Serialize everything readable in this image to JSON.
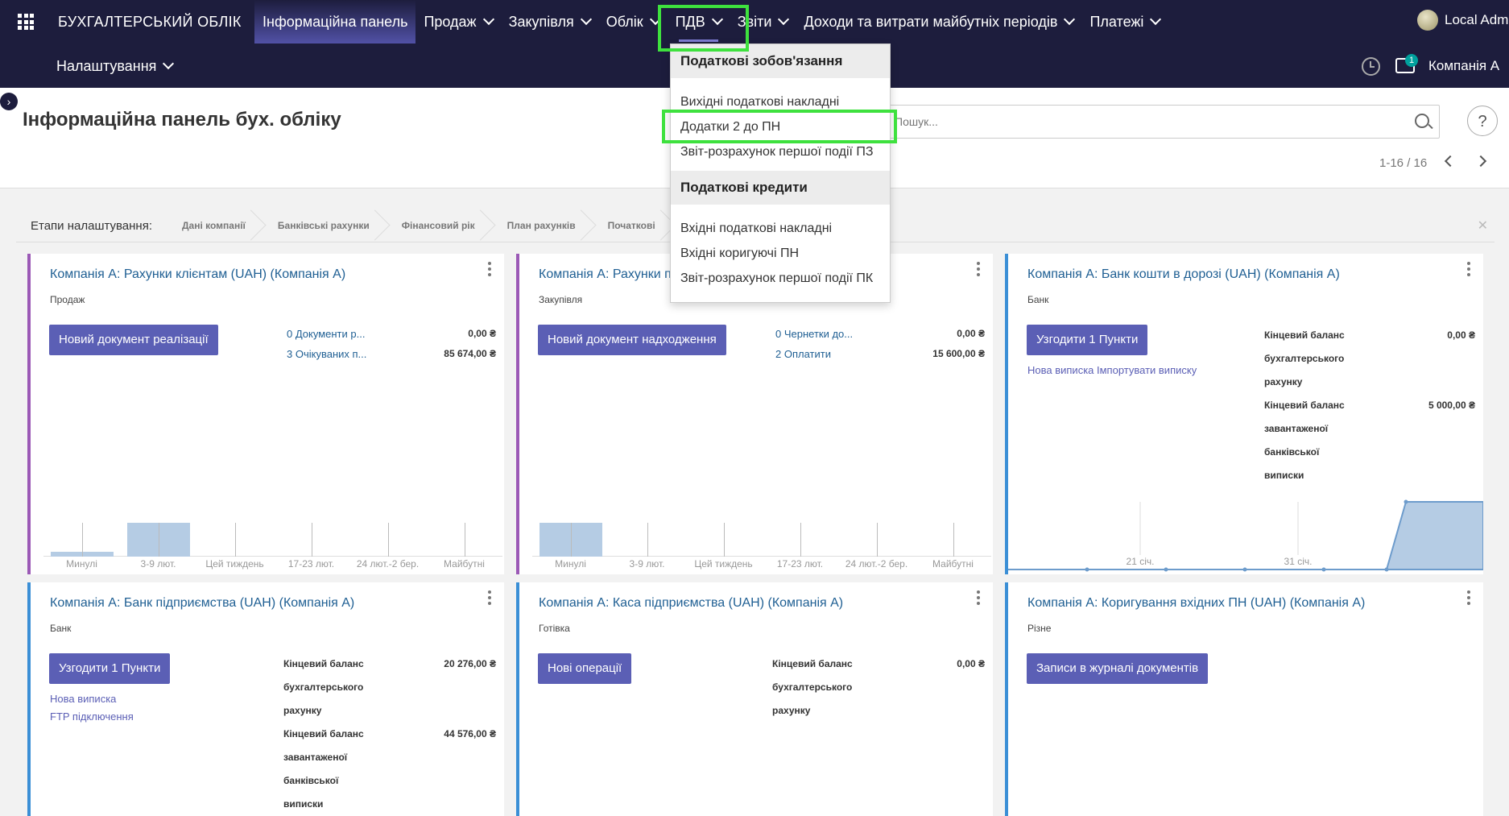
{
  "topbar": {
    "app_name": "БУХГАЛТЕРСЬКИЙ ОБЛІК",
    "menu": [
      "Інформаційна панель",
      "Продаж",
      "Закупівля",
      "Облік",
      "ПДВ",
      "Звіти",
      "Доходи та витрати майбутніх періодів",
      "Платежі"
    ],
    "settings": "Налаштування",
    "user_name": "Local Adm",
    "company": "Компанія А",
    "messages_count": "1"
  },
  "control": {
    "title": "Інформаційна панель бух. обліку",
    "search_placeholder": "Пошук...",
    "pager": "1-16 / 16",
    "help": "?"
  },
  "setup": {
    "label": "Етапи налаштування:",
    "steps": [
      "Дані компанії",
      "Банківські рахунки",
      "Фінансовий рік",
      "План рахунків",
      "Початкові"
    ]
  },
  "vat_menu": {
    "sections": [
      {
        "header": "Податкові зобов'язання",
        "items": [
          "Вихідні податкові накладні",
          "Додатки 2 до ПН",
          "Звіт-розрахунок першої події ПЗ"
        ]
      },
      {
        "header": "Податкові кредити",
        "items": [
          "Вхідні податкові накладні",
          "Вхідні коригуючі ПН",
          "Звіт-розрахунок першої події ПК"
        ]
      }
    ]
  },
  "cards": {
    "sales": {
      "title": "Компанія А: Рахунки клієнтам (UAH) (Компанія А)",
      "type": "Продаж",
      "button": "Новий документ реалізації",
      "stats": [
        {
          "label": "0 Документи р...",
          "value": "0,00 ₴"
        },
        {
          "label": "3 Очікуваних п...",
          "value": "85 674,00 ₴"
        }
      ]
    },
    "purchase": {
      "title": "Компанія А: Рахунки п",
      "type": "Закупівля",
      "button": "Новий документ надходження",
      "stats": [
        {
          "label": "0 Чернетки до...",
          "value": "0,00 ₴"
        },
        {
          "label": "2 Оплатити",
          "value": "15 600,00 ₴"
        }
      ]
    },
    "transit": {
      "title": "Компанія А: Банк кошти в дорозі (UAH) (Компанія А)",
      "type": "Банк",
      "button": "Узгодити 1 Пункти",
      "links": "Нова виписка Імпортувати виписку",
      "balance_lines": [
        "Кінцевий баланс",
        "бухгалтерського",
        "рахунку",
        "Кінцевий баланс",
        "завантаженої",
        "банківської",
        "виписки"
      ],
      "balance_values": [
        "0,00 ₴",
        "5 000,00 ₴"
      ]
    },
    "bank": {
      "title": "Компанія А: Банк підприємства (UAH) (Компанія А)",
      "type": "Банк",
      "button": "Узгодити 1 Пункти",
      "links": [
        "Нова виписка",
        "FTP підключення"
      ],
      "balance_lines": [
        "Кінцевий баланс",
        "бухгалтерського",
        "рахунку",
        "Кінцевий баланс",
        "завантаженої",
        "банківської",
        "виписки"
      ],
      "balance_values": [
        "20 276,00 ₴",
        "44 576,00 ₴"
      ]
    },
    "cash": {
      "title": "Компанія А: Каса підприємства (UAH) (Компанія А)",
      "type": "Готівка",
      "button": "Нові операції",
      "balance_lines": [
        "Кінцевий баланс",
        "бухгалтерського",
        "рахунку"
      ],
      "balance_values": [
        "0,00 ₴"
      ]
    },
    "correction": {
      "title": "Компанія А: Коригування вхідних ПН (UAH) (Компанія А)",
      "type": "Різне",
      "button": "Записи в журналі документів"
    }
  },
  "chart_data": [
    {
      "type": "bar",
      "categories": [
        "Минулі",
        "3-9 лют.",
        "Цей тиждень",
        "17-23 лют.",
        "24 лют.-2 бер.",
        "Майбутні"
      ],
      "values": [
        0.15,
        1,
        0,
        0,
        0,
        0
      ]
    },
    {
      "type": "bar",
      "categories": [
        "Минулі",
        "3-9 лют.",
        "Цей тиждень",
        "17-23 лют.",
        "24 лют.-2 бер.",
        "Майбутні"
      ],
      "values": [
        1,
        0,
        0,
        0,
        0,
        0
      ]
    },
    {
      "type": "area",
      "x": [
        "21 січ.",
        "31 січ."
      ],
      "series_values": [
        0,
        0,
        0,
        0,
        0,
        0,
        1,
        1
      ]
    }
  ],
  "colors": {
    "topbar": "#1d1d3d",
    "accent": "#5b5fb5",
    "sales_border": "#9b59b6",
    "bank_border": "#3b8fd6",
    "highlight": "#3ee13e"
  }
}
